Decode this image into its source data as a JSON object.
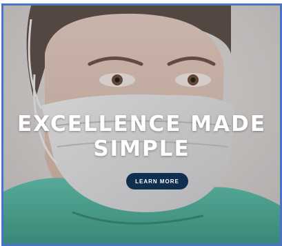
{
  "hero": {
    "headline_line1": "EXCELLENCE MADE",
    "headline_line2": "SIMPLE",
    "cta_label": "LEARN MORE"
  },
  "colors": {
    "frame_border": "#4a72c8",
    "cta_background": "#0e2f4f",
    "scrubs": "#4fb4a0"
  }
}
